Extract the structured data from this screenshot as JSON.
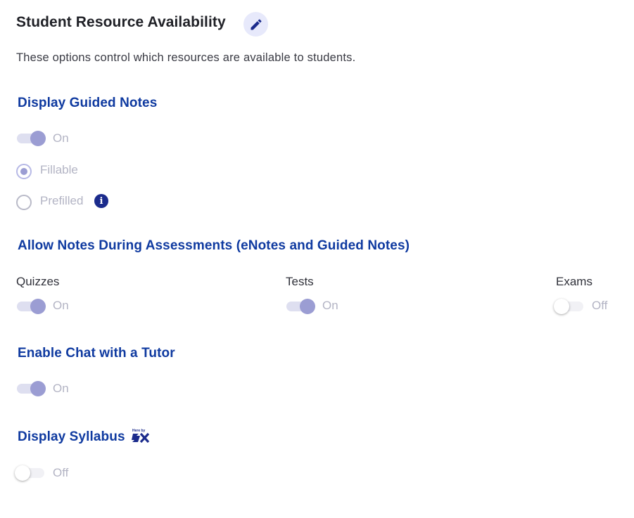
{
  "header": {
    "title": "Student Resource Availability",
    "description": "These options control which resources are available to students.",
    "edit_icon": "pencil-icon"
  },
  "guided_notes": {
    "title": "Display Guided Notes",
    "toggle": {
      "state": "on",
      "label": "On"
    },
    "options": [
      {
        "label": "Fillable",
        "selected": true
      },
      {
        "label": "Prefilled",
        "selected": false,
        "info_icon": "info-icon"
      }
    ]
  },
  "assessment_notes": {
    "title": "Allow Notes During Assessments (eNotes and Guided Notes)",
    "columns": [
      {
        "label": "Quizzes",
        "state": "on",
        "toggle_label": "On"
      },
      {
        "label": "Tests",
        "state": "on",
        "toggle_label": "On"
      },
      {
        "label": "Exams",
        "state": "off",
        "toggle_label": "Off"
      }
    ]
  },
  "tutor_chat": {
    "title": "Enable Chat with a Tutor",
    "toggle": {
      "state": "on",
      "label": "On"
    }
  },
  "syllabus": {
    "title": "Display Syllabus",
    "badge_icon": "sx-brand-icon",
    "badge_text": "Here by",
    "toggle": {
      "state": "off",
      "label": "Off"
    }
  },
  "colors": {
    "section_title": "#0f3aa0",
    "toggle_on_thumb": "#9b9dd3",
    "toggle_on_track": "#dedff0",
    "disabled_text": "#b3b4c4",
    "info_icon": "#1b2b8c"
  }
}
